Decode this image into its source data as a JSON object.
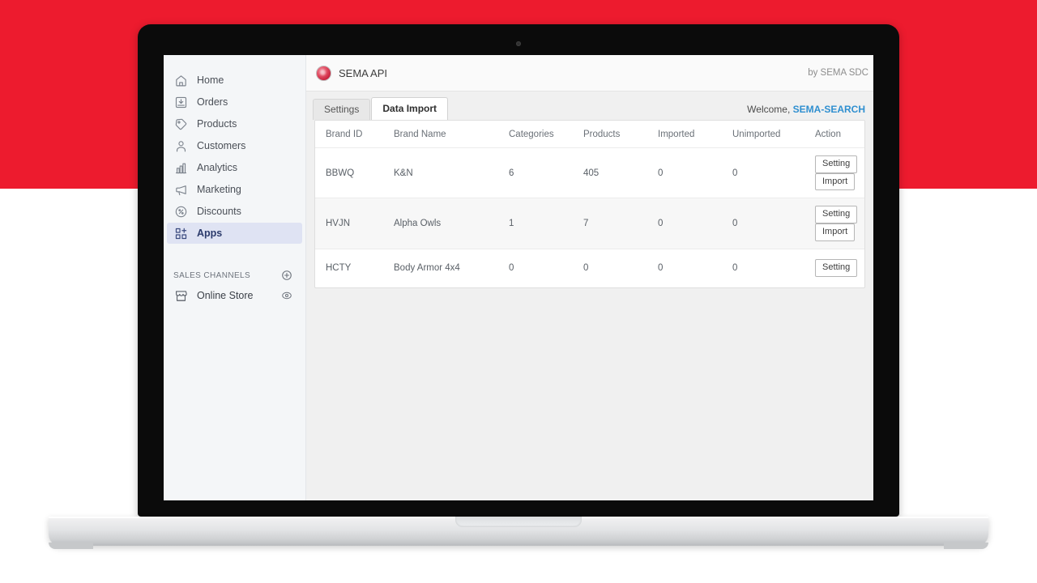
{
  "background": {
    "band_color": "#ED1B2E",
    "lower_color": "#FFFFFF"
  },
  "sidebar": {
    "items": [
      {
        "label": "Home",
        "icon": "home-icon",
        "active": false
      },
      {
        "label": "Orders",
        "icon": "orders-icon",
        "active": false
      },
      {
        "label": "Products",
        "icon": "products-tag-icon",
        "active": false
      },
      {
        "label": "Customers",
        "icon": "customers-icon",
        "active": false
      },
      {
        "label": "Analytics",
        "icon": "analytics-bar-chart-icon",
        "active": false
      },
      {
        "label": "Marketing",
        "icon": "marketing-megaphone-icon",
        "active": false
      },
      {
        "label": "Discounts",
        "icon": "discounts-percent-icon",
        "active": false
      },
      {
        "label": "Apps",
        "icon": "apps-grid-plus-icon",
        "active": true
      }
    ],
    "sales_channels": {
      "title": "SALES CHANNELS",
      "add_icon": "plus-circle-icon",
      "channels": [
        {
          "label": "Online Store",
          "icon": "online-store-icon",
          "action_icon": "eye-icon"
        }
      ]
    },
    "active_bg": "#dfe3f3",
    "active_fg": "#2b3a6b"
  },
  "app_header": {
    "logo_icon": "sema-app-logo-icon",
    "title": "SEMA API",
    "by_line": "by SEMA SDC"
  },
  "tabs": [
    {
      "label": "Settings",
      "active": false
    },
    {
      "label": "Data Import",
      "active": true
    }
  ],
  "welcome": {
    "greeting": "Welcome,",
    "user": "SEMA-SEARCH",
    "user_color": "#2f8fd0"
  },
  "table": {
    "columns": [
      "Brand ID",
      "Brand Name",
      "Categories",
      "Products",
      "Imported",
      "Unimported",
      "Action"
    ],
    "rows": [
      {
        "brand_id": "BBWQ",
        "brand_name": "K&N",
        "categories": "6",
        "products": "405",
        "imported": "0",
        "unimported": "0",
        "actions": [
          "Setting",
          "Import"
        ]
      },
      {
        "brand_id": "HVJN",
        "brand_name": "Alpha Owls",
        "categories": "1",
        "products": "7",
        "imported": "0",
        "unimported": "0",
        "actions": [
          "Setting",
          "Import"
        ]
      },
      {
        "brand_id": "HCTY",
        "brand_name": "Body Armor 4x4",
        "categories": "0",
        "products": "0",
        "imported": "0",
        "unimported": "0",
        "actions": [
          "Setting"
        ]
      }
    ]
  }
}
